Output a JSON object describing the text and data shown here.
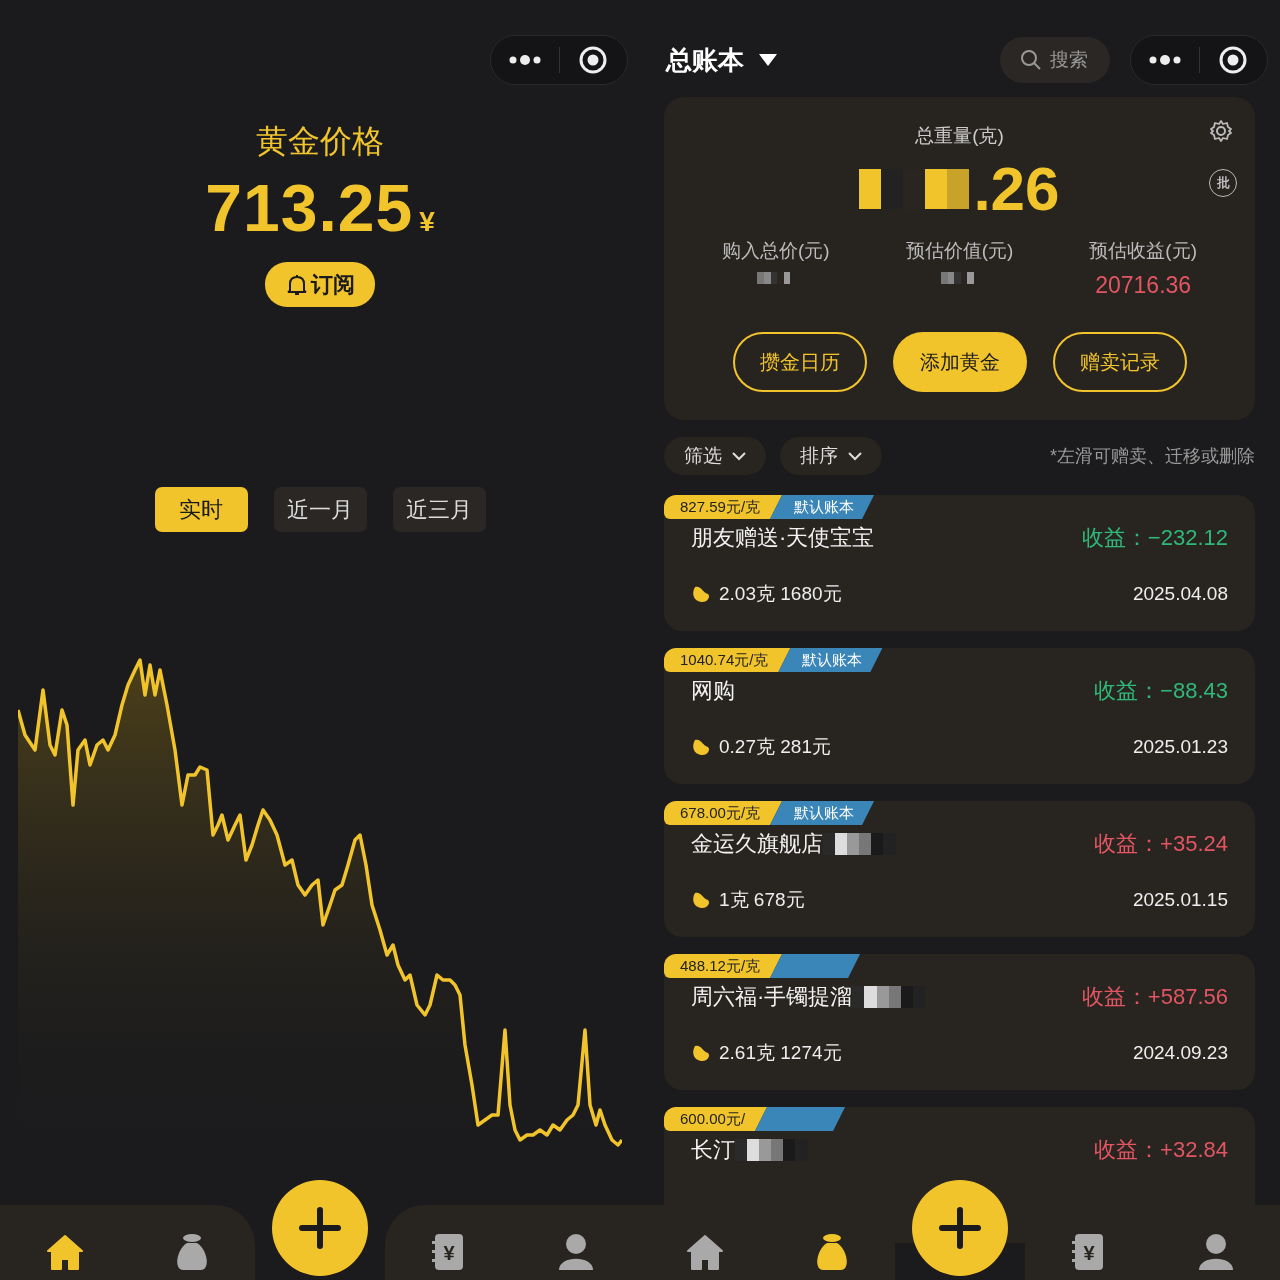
{
  "price_screen": {
    "title": "黄金价格",
    "price": "713.25",
    "currency": "¥",
    "subscribe_button": "订阅",
    "ranges": [
      {
        "label": "实时",
        "selected": true
      },
      {
        "label": "近一月",
        "selected": false
      },
      {
        "label": "近三月",
        "selected": false
      }
    ],
    "tab_bar": [
      {
        "kind": "home",
        "selected": true
      },
      {
        "kind": "bag",
        "selected": false
      },
      {
        "kind": "add"
      },
      {
        "kind": "ledger",
        "glyph": "¥",
        "selected": false
      },
      {
        "kind": "person",
        "selected": false
      }
    ]
  },
  "ledger_screen": {
    "book_title": "总账本",
    "search": {
      "placeholder": "搜索"
    },
    "summary": {
      "weight_label": "总重量(克)",
      "weight": ".26",
      "weight_redacted": true,
      "batch_icon_text": "批",
      "stats": [
        {
          "label": "购入总价(元)",
          "redacted": true
        },
        {
          "label": "预估价值(元)",
          "redacted": true
        },
        {
          "label": "预估收益(元)",
          "value": "20716.36",
          "color": "#e25563",
          "redacted": false
        }
      ],
      "buttons": [
        {
          "label": "攒金日历",
          "kind": "outline"
        },
        {
          "label": "添加黄金",
          "kind": "filled"
        },
        {
          "label": "赠卖记录",
          "kind": "outline"
        }
      ]
    },
    "filters": [
      "筛选",
      "排序"
    ],
    "hint": "*左滑可赠卖、迁移或删除",
    "records": [
      {
        "unit_price": "827.59元/克",
        "book": "默认账本",
        "name": "朋友赠送·天使宝宝",
        "redacted": false,
        "profit_label": "收益：",
        "profit": "−232.12",
        "color": "#2fb87a",
        "amount": "2.03克 1680元",
        "date": "2025.04.08"
      },
      {
        "unit_price": "1040.74元/克",
        "book": "默认账本",
        "name": "网购",
        "redacted": false,
        "profit_label": "收益：",
        "profit": "−88.43",
        "color": "#2fb87a",
        "amount": "0.27克 281元",
        "date": "2025.01.23"
      },
      {
        "unit_price": "678.00元/克",
        "book": "默认账本",
        "name": "金运久旗舰店",
        "redacted": true,
        "profit_label": "收益：",
        "profit": "+35.24",
        "color": "#e25563",
        "amount": "1克 678元",
        "date": "2025.01.15"
      },
      {
        "unit_price": "488.12元/克",
        "name": "周六福·手镯提溜",
        "redacted": true,
        "profit_label": "收益：",
        "profit": "+587.56",
        "color": "#e25563",
        "amount": "2.61克 1274元",
        "date": "2024.09.23"
      },
      {
        "unit_price": "600.00元/",
        "name": "长汀",
        "redacted": true,
        "profit_label": "收益：",
        "profit": "+32.84",
        "color": "#e25563"
      }
    ],
    "tab_bar": [
      {
        "kind": "home",
        "selected": false
      },
      {
        "kind": "bag",
        "selected": true
      },
      {
        "kind": "add"
      },
      {
        "kind": "ledger",
        "glyph": "¥",
        "selected": false
      },
      {
        "kind": "person",
        "selected": false
      }
    ]
  }
}
